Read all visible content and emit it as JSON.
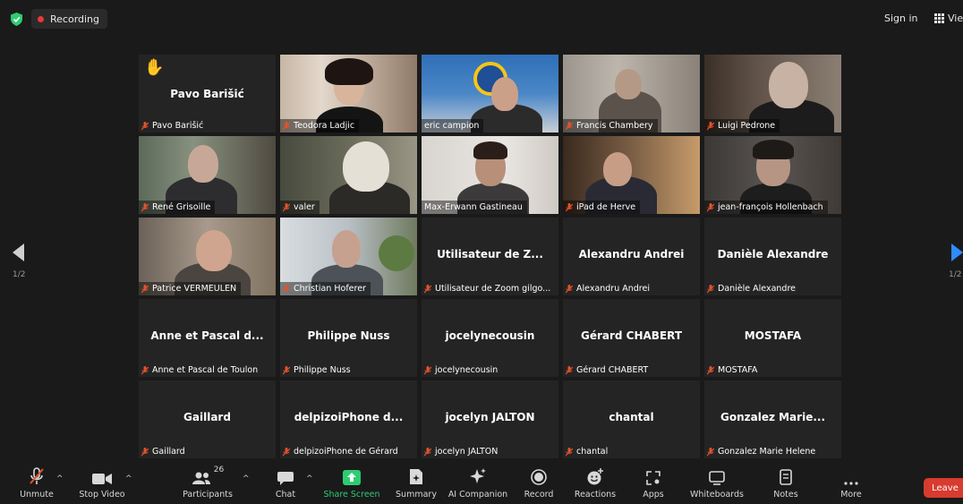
{
  "topbar": {
    "recording_label": "Recording",
    "sign_in": "Sign in",
    "view": "View"
  },
  "pager": {
    "left_page": "1/2",
    "right_page": "1/2"
  },
  "tiles": [
    {
      "title": "Pavo Barišić",
      "label": "Pavo Barišić",
      "hand_raised": true
    },
    {
      "label": "Teodora Ladjic"
    },
    {
      "label": "eric campion"
    },
    {
      "label": "Francis Chambery"
    },
    {
      "label": "Luigi Pedrone"
    },
    {
      "label": "René Grisoille"
    },
    {
      "label": "valer"
    },
    {
      "label": "Max-Erwann Gastineau",
      "active_speaker": true
    },
    {
      "label": "iPad de Herve"
    },
    {
      "label": "jean-françois Hollenbach"
    },
    {
      "label": "Patrice VERMEULEN"
    },
    {
      "label": "Christian Hoferer"
    },
    {
      "title": "Utilisateur de Z...",
      "label": "Utilisateur de Zoom gilgo..."
    },
    {
      "title": "Alexandru Andrei",
      "label": "Alexandru Andrei"
    },
    {
      "title": "Danièle Alexandre",
      "label": "Danièle Alexandre"
    },
    {
      "title": "Anne et Pascal d...",
      "label": "Anne et Pascal de Toulon"
    },
    {
      "title": "Philippe Nuss",
      "label": "Philippe Nuss"
    },
    {
      "title": "jocelynecousin",
      "label": "jocelynecousin"
    },
    {
      "title": "Gérard CHABERT",
      "label": "Gérard CHABERT"
    },
    {
      "title": "MOSTAFA",
      "label": "MOSTAFA"
    },
    {
      "title": "Gaillard",
      "label": "Gaillard"
    },
    {
      "title": "delpizoiPhone d...",
      "label": "delpizoiPhone de Gérard"
    },
    {
      "title": "jocelyn JALTON",
      "label": "jocelyn JALTON"
    },
    {
      "title": "chantal",
      "label": "chantal"
    },
    {
      "title": "Gonzalez Marie...",
      "label": "Gonzalez Marie Helene"
    }
  ],
  "toolbar": {
    "unmute": "Unmute",
    "stop_video": "Stop Video",
    "participants": "Participants",
    "participants_count": "26",
    "chat": "Chat",
    "share_screen": "Share Screen",
    "summary": "Summary",
    "ai_companion": "AI Companion",
    "record": "Record",
    "reactions": "Reactions",
    "apps": "Apps",
    "whiteboards": "Whiteboards",
    "notes": "Notes",
    "more": "More",
    "leave": "Leave"
  },
  "colors": {
    "recording_dot": "#e8393a",
    "shield": "#2ecc71",
    "share_screen": "#2ecc71",
    "active_speaker_border": "#c9e36b",
    "leave_button": "#d83b2f",
    "pager_right_arrow": "#2d8cff",
    "muted_mic": "#e2532c"
  },
  "icons": {
    "shield": "shield-check-icon",
    "mic": "microphone-muted-icon",
    "camera": "video-camera-icon",
    "participants": "people-icon",
    "chat": "speech-bubble-icon",
    "share": "share-screen-arrow-icon",
    "summary": "document-sparkle-icon",
    "ai": "sparkle-icon",
    "record": "record-circle-icon",
    "reactions": "smiley-plus-icon",
    "apps": "apps-grid-icon",
    "whiteboards": "whiteboard-icon",
    "notes": "notes-icon",
    "more": "ellipsis-icon",
    "hand": "raised-hand-icon"
  }
}
